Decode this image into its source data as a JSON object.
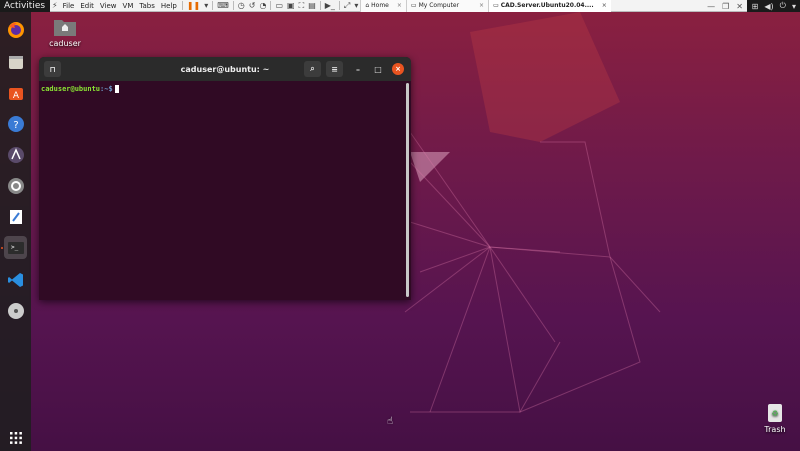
{
  "topbar": {
    "activities": "Activities",
    "right_icons": [
      "network-icon",
      "volume-icon",
      "power-icon",
      "dropdown-icon"
    ]
  },
  "vmware": {
    "menus": [
      "File",
      "Edit",
      "View",
      "VM",
      "Tabs",
      "Help"
    ],
    "tabs": [
      {
        "label": "Home",
        "active": false
      },
      {
        "label": "My Computer",
        "active": false
      },
      {
        "label": "CAD.Server.Ubuntu20.04....",
        "active": true
      }
    ]
  },
  "desktop": {
    "home_icon_label": "caduser",
    "trash_label": "Trash"
  },
  "terminal": {
    "title": "caduser@ubuntu: ~",
    "prompt_user": "caduser@ubuntu",
    "prompt_path": ":~$"
  },
  "dock": {
    "items": [
      "firefox-icon",
      "files-icon",
      "software-icon",
      "help-icon",
      "aptik-icon",
      "settings-icon",
      "text-editor-icon",
      "terminal-icon",
      "vscode-icon",
      "disc-icon",
      "app-grid-icon"
    ]
  },
  "colors": {
    "ubuntu_orange": "#e95420",
    "terminal_bg": "#300a24",
    "prompt_green": "#8ae234",
    "prompt_blue": "#729fcf"
  }
}
